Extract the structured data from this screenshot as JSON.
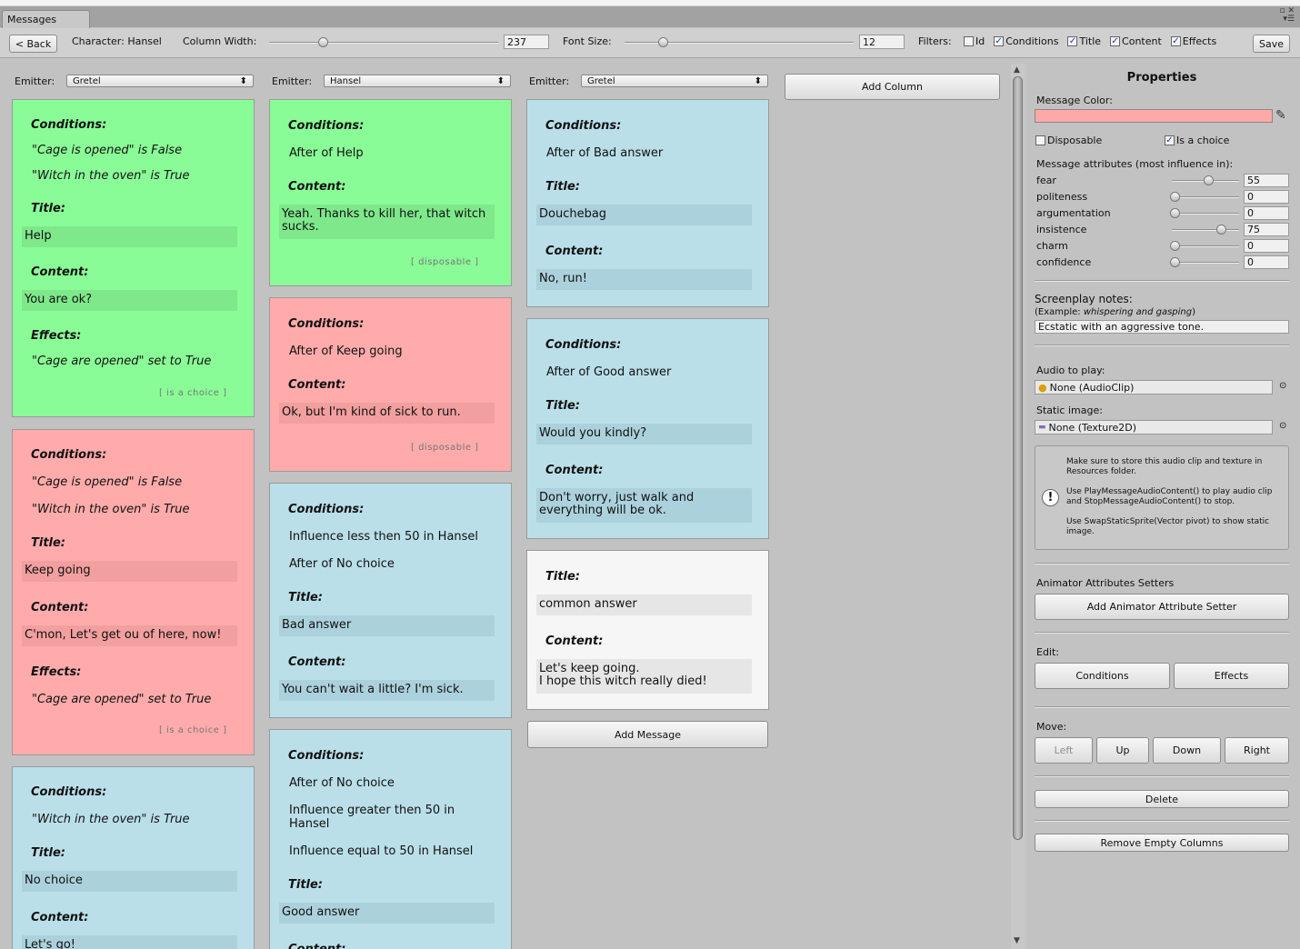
{
  "window": {
    "tab_title": "Messages",
    "controls_icon": "window-controls-icon",
    "controls_text": "▫ ✕\n▾☰"
  },
  "toolbar": {
    "back_label": "< Back",
    "character_label": "Character: Hansel",
    "column_width_label": "Column Width:",
    "column_width_value": "237",
    "column_width_fraction": 0.22,
    "font_size_label": "Font Size:",
    "font_size_value": "12",
    "font_size_fraction": 0.15,
    "filters_label": "Filters:",
    "filters": [
      {
        "label": "Id",
        "checked": false
      },
      {
        "label": "Conditions",
        "checked": true
      },
      {
        "label": "Title",
        "checked": true
      },
      {
        "label": "Content",
        "checked": true
      },
      {
        "label": "Effects",
        "checked": true
      }
    ],
    "save_label": "Save"
  },
  "columns": [
    {
      "emitter_label": "Emitter:",
      "emitter_value": "Gretel"
    },
    {
      "emitter_label": "Emitter:",
      "emitter_value": "Hansel"
    },
    {
      "emitter_label": "Emitter:",
      "emitter_value": "Gretel"
    }
  ],
  "add_column_label": "Add Column",
  "add_message_label": "Add Message",
  "labels": {
    "conditions": "Conditions:",
    "title": "Title:",
    "content": "Content:",
    "effects": "Effects:"
  },
  "cards": {
    "c1m1": {
      "cond1": "\"Cage is opened\" is False",
      "cond2": "\"Witch in the oven\" is True",
      "title": "Help",
      "content": "You are ok?",
      "effect": "\"Cage are opened\" set to True",
      "tag": "[ is a choice ]"
    },
    "c1m2": {
      "cond1": "\"Cage is opened\" is False",
      "cond2": "\"Witch in the oven\" is True",
      "title": "Keep going",
      "content": "C'mon, Let's get ou of here, now!",
      "effect": "\"Cage are opened\" set to True",
      "tag": "[ is a choice ]"
    },
    "c1m3": {
      "cond1": "\"Witch in the oven\" is True",
      "title": "No choice",
      "content": "Let's go!"
    },
    "c2m1": {
      "cond1": "After of Help",
      "content": "Yeah. Thanks to kill her, that witch sucks.",
      "tag": "[ disposable ]"
    },
    "c2m2": {
      "cond1": "After of Keep going",
      "content": "Ok, but I'm kind of sick to run.",
      "tag": "[ disposable ]"
    },
    "c2m3": {
      "cond1": "Influence less then 50 in Hansel",
      "cond2": "After of No choice",
      "title": "Bad answer",
      "content": "You can't wait a little? I'm sick."
    },
    "c2m4": {
      "cond1": "After of No choice",
      "cond2": "Influence greater then 50 in Hansel",
      "cond3": "Influence equal to 50 in Hansel",
      "title": "Good answer"
    },
    "c3m1": {
      "cond1": "After of Bad answer",
      "title": "Douchebag",
      "content": "No, run!"
    },
    "c3m2": {
      "cond1": "After of Good answer",
      "title": "Would you kindly?",
      "content": "Don't worry, just walk and everything will be ok."
    },
    "c3m3": {
      "title": "common answer",
      "content": "Let's keep going.\nI hope this witch really died!"
    }
  },
  "properties": {
    "header": "Properties",
    "message_color_label": "Message Color:",
    "message_color": "#ffa8a8",
    "disposable_label": "Disposable",
    "disposable_checked": false,
    "is_choice_label": "Is a choice",
    "is_choice_checked": true,
    "attributes_label": "Message attributes (most influence in):",
    "attributes": [
      {
        "name": "fear",
        "value": "55",
        "fraction": 0.55
      },
      {
        "name": "politeness",
        "value": "0",
        "fraction": 0
      },
      {
        "name": "argumentation",
        "value": "0",
        "fraction": 0
      },
      {
        "name": "insistence",
        "value": "75",
        "fraction": 0.75
      },
      {
        "name": "charm",
        "value": "0",
        "fraction": 0
      },
      {
        "name": "confidence",
        "value": "0",
        "fraction": 0
      }
    ],
    "screenplay_label": "Screenplay notes:",
    "screenplay_example_prefix": "(Example: ",
    "screenplay_example_italic": "whispering and gasping",
    "screenplay_example_suffix": ")",
    "screenplay_value": "Ecstatic with an aggressive tone.",
    "audio_label": "Audio to play:",
    "audio_value": "None (AudioClip)",
    "image_label": "Static image:",
    "image_value": "None (Texture2D)",
    "help1": "Make sure to store this audio clip and texture in Resources folder.",
    "help2": "Use PlayMessageAudioContent() to play audio clip and StopMessageAudioContent() to stop.",
    "help3": "Use SwapStaticSprite(Vector pivot) to show static image.",
    "animator_label": "Animator Attributes Setters",
    "add_animator_label": "Add Animator Attribute Setter",
    "edit_label": "Edit:",
    "conditions_btn": "Conditions",
    "effects_btn": "Effects",
    "move_label": "Move:",
    "left_btn": "Left",
    "up_btn": "Up",
    "down_btn": "Down",
    "right_btn": "Right",
    "delete_btn": "Delete",
    "remove_empty_btn": "Remove Empty Columns"
  }
}
